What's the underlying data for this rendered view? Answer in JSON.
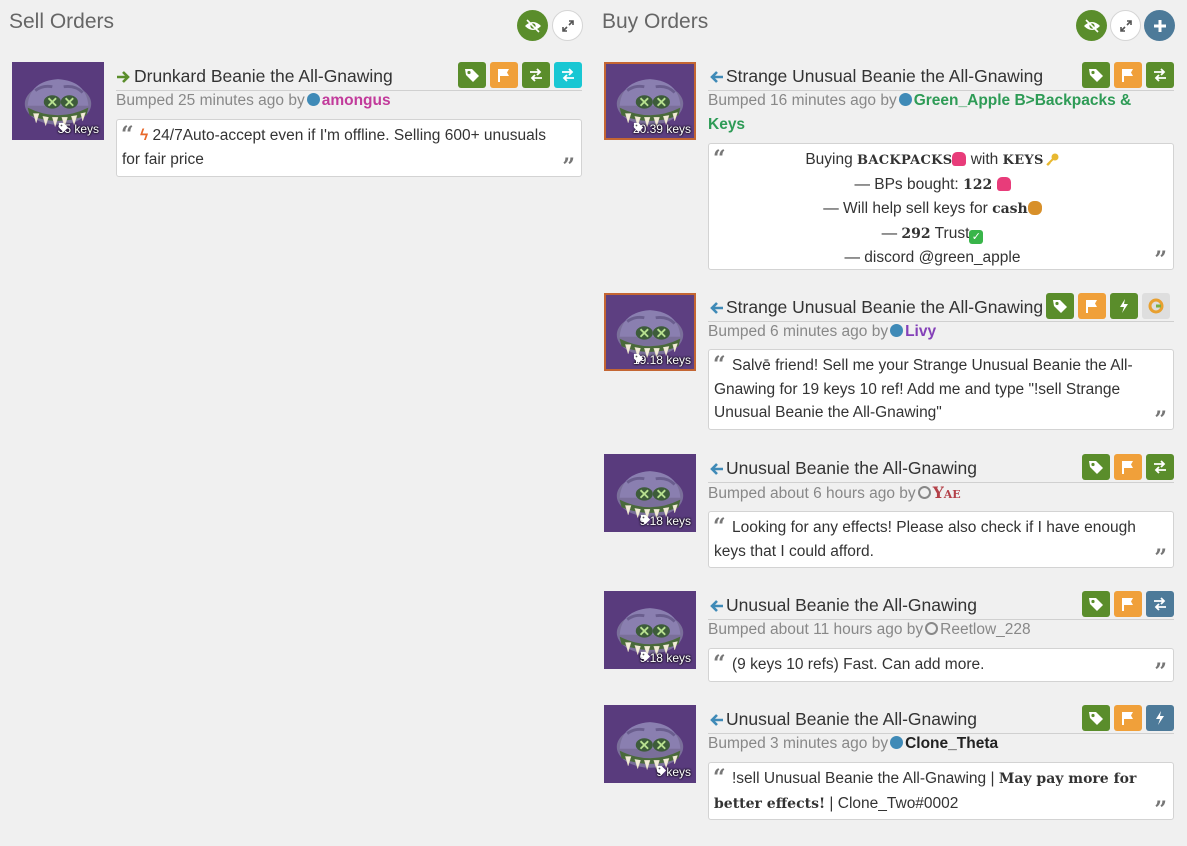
{
  "sell": {
    "title": "Sell Orders",
    "listings": [
      {
        "name": "Drunkard Beanie the All-Gnawing",
        "price": "35 keys",
        "bumped": "Bumped 25 minutes ago by",
        "user": "amongus",
        "message": "24/7Auto-accept  even if I'm offline. Selling 600+ unusuals for fair price"
      }
    ]
  },
  "buy": {
    "title": "Buy Orders",
    "listings": [
      {
        "name": "Strange Unusual Beanie the All-Gnawing",
        "price": "20.39 keys",
        "bumped": "Bumped 16 minutes ago by",
        "user_line1": "Green_Apple B>Backpacks &",
        "user_line2": "Keys",
        "msg_lines": {
          "l1a": "Buying ",
          "l1b": "BACKPACKS",
          "l1c": " with ",
          "l1d": "KEYS",
          "l2a": "— BPs bought: ",
          "l2b": "122",
          "l3a": "— Will help sell keys for ",
          "l3b": "cash",
          "l4a": "— ",
          "l4b": "292",
          "l4c": " Trust",
          "l5": "— discord @green_apple"
        }
      },
      {
        "name": "Strange Unusual Beanie the All-Gnawing",
        "price": "19.18 keys",
        "bumped": "Bumped 6 minutes ago by",
        "user": "Livy",
        "message": "Salvē friend! Sell me your Strange Unusual Beanie the All-Gnawing for 19 keys 10 ref! Add me and type \"!sell Strange Unusual Beanie the All-Gnawing\""
      },
      {
        "name": "Unusual Beanie the All-Gnawing",
        "price": "9.18 keys",
        "bumped": "Bumped about 6 hours ago by",
        "user": "Yae",
        "message": "Looking for any effects! Please also check if I have enough keys that I could afford."
      },
      {
        "name": "Unusual Beanie the All-Gnawing",
        "price": "9.18 keys",
        "bumped": "Bumped about 11 hours ago by",
        "user": "Reetlow_228",
        "message": "(9 keys 10 refs) Fast. Can add more."
      },
      {
        "name": "Unusual Beanie the All-Gnawing",
        "price": "9 keys",
        "bumped": "Bumped 3 minutes ago by",
        "user": "Clone_Theta",
        "msg_a": "!sell Unusual Beanie the All-Gnawing | ",
        "msg_b": "May pay more for better effects!",
        "msg_c": " | Clone_Two#0002"
      }
    ]
  },
  "colors": {
    "accent_green": "#5a8d2b",
    "accent_orange": "#f0a03a",
    "accent_teal": "#19c7d3",
    "accent_slate": "#4d7a99",
    "quality_unusual": "#593b7d",
    "quality_strange": "#c46633"
  }
}
